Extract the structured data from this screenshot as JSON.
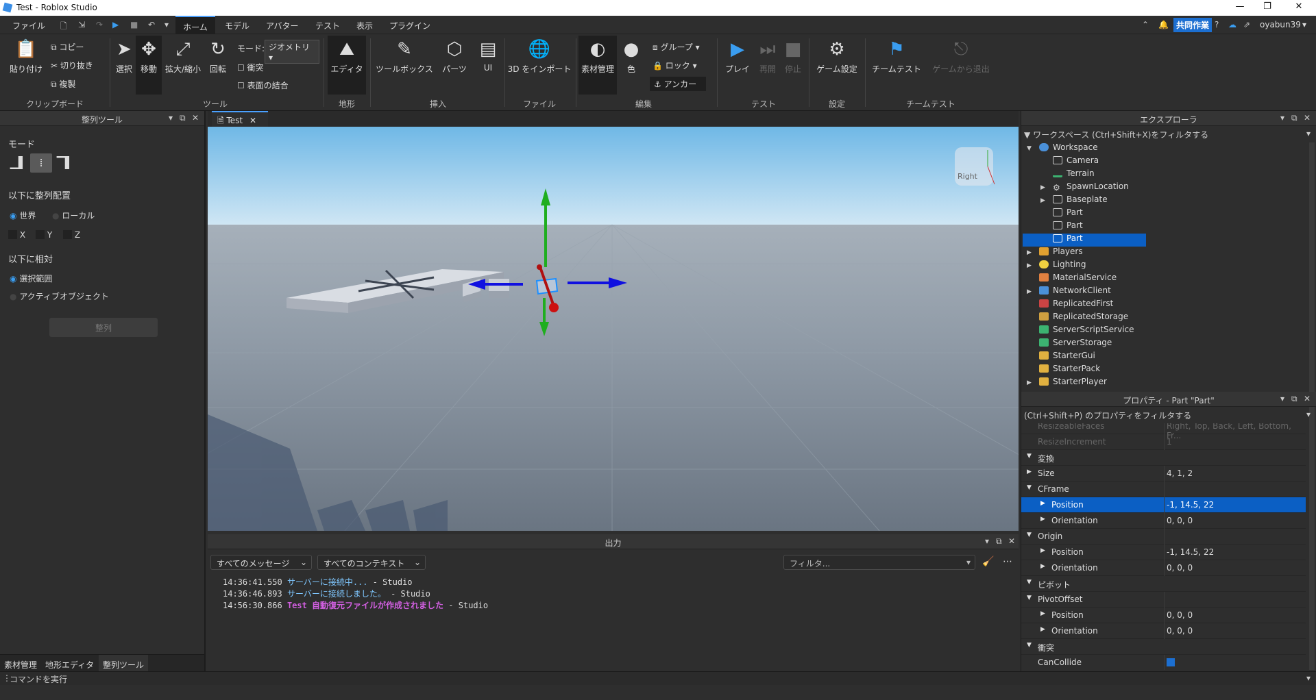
{
  "window": {
    "title": "Test - Roblox Studio"
  },
  "menu": {
    "file": "ファイル",
    "tabs": [
      "ホーム",
      "モデル",
      "アバター",
      "テスト",
      "表示",
      "プラグイン"
    ],
    "collab": "共同作業",
    "user": "oyabun39"
  },
  "ribbon": {
    "paste": "貼り付け",
    "copy": "コピー",
    "cut": "切り抜き",
    "duplicate": "複製",
    "clipboard_group": "クリップボード",
    "select": "選択",
    "move": "移動",
    "scale": "拡大/縮小",
    "rotate": "回転",
    "mode_label": "モード:",
    "mode_value": "ジオメトリ",
    "collisions": "衝突",
    "join_surfaces": "表面の結合",
    "tools_group": "ツール",
    "editor": "エディタ",
    "terrain_group": "地形",
    "toolbox": "ツールボックス",
    "parts": "パーツ",
    "ui": "UI",
    "insert_group": "挿入",
    "import3d": "3D をインポート",
    "file_group": "ファイル",
    "material_manager": "素材管理",
    "color": "色",
    "group": "グループ",
    "lock": "ロック",
    "anchor": "アンカー",
    "edit_group": "編集",
    "play": "プレイ",
    "resume": "再開",
    "stop": "停止",
    "test_group": "テスト",
    "game_settings": "ゲーム設定",
    "settings_group": "設定",
    "team_test": "チームテスト",
    "exit_game": "ゲームから退出",
    "team_test_group": "チームテスト"
  },
  "align_tool": {
    "title": "整列ツール",
    "mode": "モード",
    "align_in": "以下に整列配置",
    "world": "世界",
    "local": "ローカル",
    "x": "X",
    "y": "Y",
    "z": "Z",
    "relative_to": "以下に相対",
    "selection": "選択範囲",
    "active_object": "アクティブオブジェクト",
    "align_button": "整列"
  },
  "left_tabs": [
    "素材管理",
    "地形エディタ",
    "整列ツール"
  ],
  "doc_tab": "Test",
  "viewcube_label": "Right",
  "output": {
    "title": "出力",
    "filter_messages": "すべてのメッセージ",
    "filter_contexts": "すべてのコンテキスト",
    "filter_placeholder": "フィルタ...",
    "lines": [
      {
        "time": "14:36:41.550",
        "msg": "サーバーに接続中...",
        "src": "-  Studio"
      },
      {
        "time": "14:36:46.893",
        "msg": "サーバーに接続しました。",
        "src": "-  Studio"
      },
      {
        "time": "14:56:30.866",
        "msg": "Test 自動復元ファイルが作成されました",
        "src": "-  Studio"
      }
    ]
  },
  "explorer": {
    "title": "エクスプローラ",
    "filter": "ワークスペース (Ctrl+Shift+X)をフィルタする",
    "items": [
      {
        "label": "Workspace",
        "icon": "globe-icon",
        "color": "#4a90d9"
      },
      {
        "label": "Camera",
        "icon": "camera-icon",
        "color": "#cccccc"
      },
      {
        "label": "Terrain",
        "icon": "terrain-icon",
        "color": "#3cb371"
      },
      {
        "label": "SpawnLocation",
        "icon": "gear-icon",
        "color": "#cccccc"
      },
      {
        "label": "Baseplate",
        "icon": "cube-icon",
        "color": "#cccccc"
      },
      {
        "label": "Part",
        "icon": "cube-icon",
        "color": "#cccccc"
      },
      {
        "label": "Part",
        "icon": "cube-icon",
        "color": "#cccccc"
      },
      {
        "label": "Part",
        "icon": "cube-icon",
        "color": "#cccccc"
      },
      {
        "label": "Players",
        "icon": "players-icon",
        "color": "#e0a030"
      },
      {
        "label": "Lighting",
        "icon": "bulb-icon",
        "color": "#f0d040"
      },
      {
        "label": "MaterialService",
        "icon": "material-icon",
        "color": "#e08040"
      },
      {
        "label": "NetworkClient",
        "icon": "network-icon",
        "color": "#4a90d9"
      },
      {
        "label": "ReplicatedFirst",
        "icon": "replicated-first-icon",
        "color": "#cc4444"
      },
      {
        "label": "ReplicatedStorage",
        "icon": "replicated-storage-icon",
        "color": "#d0a040"
      },
      {
        "label": "ServerScriptService",
        "icon": "server-script-icon",
        "color": "#3cb371"
      },
      {
        "label": "ServerStorage",
        "icon": "server-storage-icon",
        "color": "#3cb371"
      },
      {
        "label": "StarterGui",
        "icon": "folder-icon",
        "color": "#e0b040"
      },
      {
        "label": "StarterPack",
        "icon": "folder-icon",
        "color": "#e0b040"
      },
      {
        "label": "StarterPlayer",
        "icon": "folder-icon",
        "color": "#e0b040"
      }
    ]
  },
  "properties": {
    "title": "プロパティ - Part \"Part\"",
    "filter": "(Ctrl+Shift+P) のプロパティをフィルタする",
    "rows": [
      {
        "name": "ResizeableFaces",
        "value": "Right, Top, Back, Left, Bottom, Fr..."
      },
      {
        "name": "ResizeIncrement",
        "value": "1"
      },
      {
        "name": "変換",
        "value": ""
      },
      {
        "name": "Size",
        "value": "4, 1, 2"
      },
      {
        "name": "CFrame",
        "value": ""
      },
      {
        "name": "Position",
        "value": "-1, 14.5, 22"
      },
      {
        "name": "Orientation",
        "value": "0, 0, 0"
      },
      {
        "name": "Origin",
        "value": ""
      },
      {
        "name": "Position",
        "value": "-1, 14.5, 22"
      },
      {
        "name": "Orientation",
        "value": "0, 0, 0"
      },
      {
        "name": "ピボット",
        "value": ""
      },
      {
        "name": "PivotOffset",
        "value": ""
      },
      {
        "name": "Position",
        "value": "0, 0, 0"
      },
      {
        "name": "Orientation",
        "value": "0, 0, 0"
      },
      {
        "name": "衝突",
        "value": ""
      },
      {
        "name": "CanCollide",
        "value": ""
      }
    ]
  },
  "command_bar": {
    "placeholder": "コマンドを実行"
  },
  "colors": {
    "accent": "#1c6fd1",
    "selection": "#0b5fc4",
    "viewport_sky": "#8ec6ea",
    "ground": "#7d8793"
  }
}
